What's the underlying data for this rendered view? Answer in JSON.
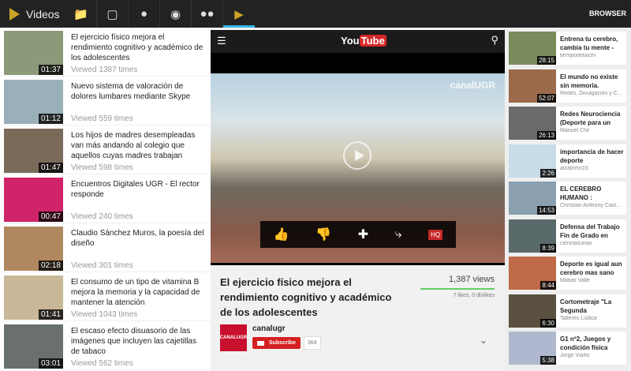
{
  "topbar": {
    "title": "Videos",
    "browser": "BROWSER",
    "icons": [
      "folder-icon",
      "calendar-icon",
      "person-icon",
      "location-pin-icon",
      "group-icon",
      "play-icon"
    ]
  },
  "left_list": [
    {
      "title": "El ejercicio físico mejora el rendimiento cognitivo y académico de los adolescentes",
      "duration": "01:37",
      "views": "Viewed 1387 times"
    },
    {
      "title": "Nuevo sistema de valoración de dolores lumbares mediante Skype",
      "duration": "01:12",
      "views": "Viewed 559 times"
    },
    {
      "title": "Los hijos de madres desempleadas van más andando al colegio que aquellos cuyas madres trabajan",
      "duration": "01:47",
      "views": "Viewed 598 times"
    },
    {
      "title": "Encuentros Digitales UGR - El rector responde",
      "duration": "00:47",
      "views": "Viewed 240 times"
    },
    {
      "title": "Claudio Sánchez Muros, la poesía del diseño",
      "duration": "02:18",
      "views": "Viewed 301 times"
    },
    {
      "title": "El consumo de un tipo de vitamina B mejora la memoria y la capacidad de mantener la atención",
      "duration": "01:41",
      "views": "Viewed 1043 times"
    },
    {
      "title": "El escaso efecto disuasorio de las imágenes que incluyen las cajetillas de tabaco",
      "duration": "03:01",
      "views": "Viewed 562 times"
    }
  ],
  "player": {
    "logo_you": "You",
    "logo_tube": "Tube",
    "watermark": "canalUGR",
    "hq": "HQ"
  },
  "video": {
    "title": "El ejercicio físico mejora el rendimiento cognitivo y académico de los adolescentes",
    "views": "1,387 views",
    "likes": "7 likes, 0 dislikes",
    "like_ratio": 1.0,
    "channel": "canalugr",
    "channel_logo": "CANALUGR",
    "subscribe": "Subscribe",
    "subscribers": "364"
  },
  "right_list": [
    {
      "title": "Entrena tu cerebro, cambia tu mente -",
      "channel": "tiempodetaichi",
      "duration": "28:15"
    },
    {
      "title": "El mundo no existe sin memoria.",
      "channel": "Redes, Divulgación y C...",
      "duration": "52:07"
    },
    {
      "title": "Redes Neurociencia (Deporte para un",
      "channel": "Manuel Chil",
      "duration": "26:13"
    },
    {
      "title": "importancia de hacer deporte",
      "channel": "alzatinho15",
      "duration": "2:26"
    },
    {
      "title": "EL CEREBRO HUMANO :",
      "channel": "Christian Anthony Cast...",
      "duration": "14:53"
    },
    {
      "title": "Defensa del Trabajo Fin de Grado en",
      "channel": "cienciasunav",
      "duration": "8:39"
    },
    {
      "title": "Deporte es igual aun cerebro mas sano",
      "channel": "Matias Valle",
      "duration": "8:44"
    },
    {
      "title": "Cortometraje \"La Segunda",
      "channel": "Talleres Lúdica",
      "duration": "6:30"
    },
    {
      "title": "G1 nº2, Juegos y condición física",
      "channel": "Jorge Viaño",
      "duration": "5:38"
    }
  ]
}
